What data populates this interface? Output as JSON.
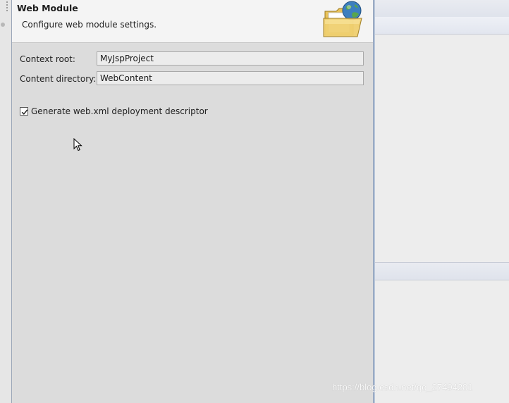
{
  "banner": {
    "title": "Web Module",
    "description": "Configure web module settings.",
    "icon": "web-folder-globe-icon"
  },
  "form": {
    "context_root": {
      "label": "Context root:",
      "value": "MyJspProject"
    },
    "content_directory": {
      "label": "Content directory:",
      "value": "WebContent"
    },
    "generate_descriptor": {
      "label": "Generate web.xml deployment descriptor",
      "checked": true
    }
  },
  "watermark": "https://blog.csdn.net/qq_27494201",
  "colors": {
    "dialog_bg": "#dcdcdc",
    "banner_bg": "#f4f4f4",
    "field_bg": "#ececec",
    "border_accent": "#8fa0bb"
  }
}
